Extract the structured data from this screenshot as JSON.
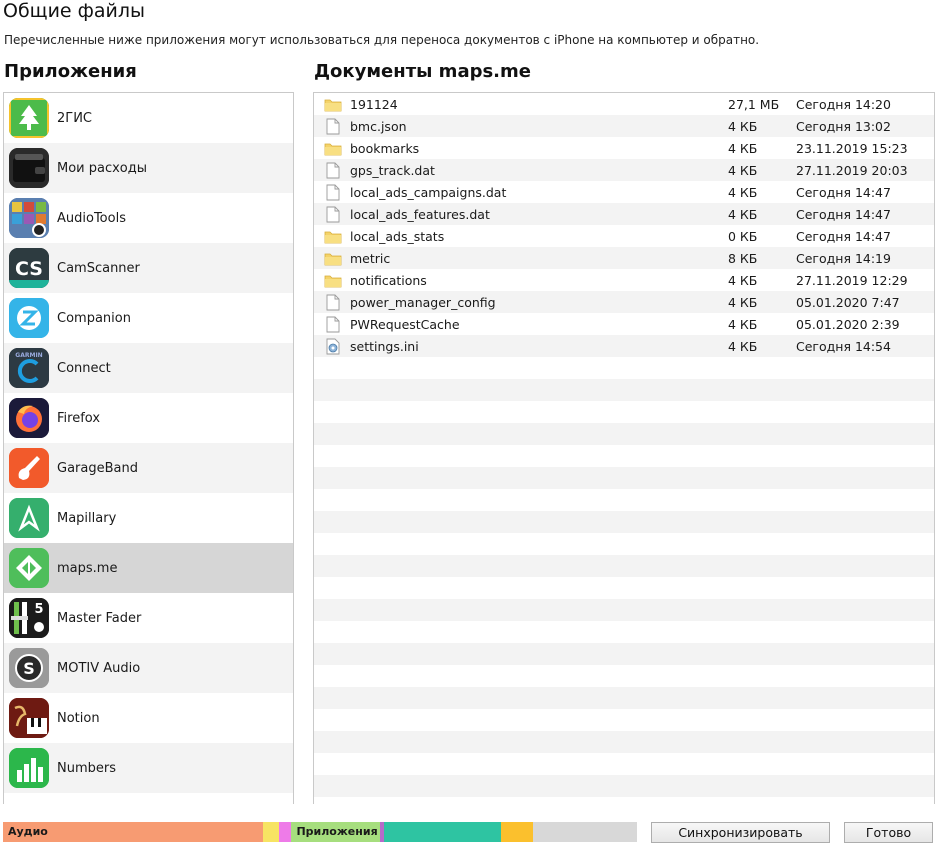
{
  "header": {
    "title": "Общие файлы",
    "subtitle": "Перечисленные ниже приложения могут использоваться для переноса документов с iPhone на компьютер и обратно."
  },
  "apps_section": {
    "title": "Приложения"
  },
  "docs_section": {
    "title": "Документы maps.me"
  },
  "apps": [
    {
      "label": "2ГИС",
      "icon": "2gis-icon",
      "color": "#4cbb4a"
    },
    {
      "label": "Мои расходы",
      "icon": "wallet-icon",
      "color": "#2b2b2b"
    },
    {
      "label": "AudioTools",
      "icon": "audiotools-icon",
      "color": "#3a5c8c"
    },
    {
      "label": "CamScanner",
      "icon": "camscanner-icon",
      "color": "#2a3a3f"
    },
    {
      "label": "Companion",
      "icon": "companion-icon",
      "color": "#3ab5e6"
    },
    {
      "label": "Connect",
      "icon": "garmin-connect-icon",
      "color": "#2e3b44"
    },
    {
      "label": "Firefox",
      "icon": "firefox-icon",
      "color": "#1c1b3a"
    },
    {
      "label": "GarageBand",
      "icon": "garageband-icon",
      "color": "#f05a2a"
    },
    {
      "label": "Mapillary",
      "icon": "mapillary-icon",
      "color": "#35af6d"
    },
    {
      "label": "maps.me",
      "icon": "mapsme-icon",
      "color": "#4fbe5b"
    },
    {
      "label": "Master Fader",
      "icon": "master-fader-icon",
      "color": "#1d1d1d"
    },
    {
      "label": "MOTIV Audio",
      "icon": "motiv-audio-icon",
      "color": "#8a8a8a"
    },
    {
      "label": "Notion",
      "icon": "notion-icon",
      "color": "#7a1b10"
    },
    {
      "label": "Numbers",
      "icon": "numbers-icon",
      "color": "#2bb64a"
    }
  ],
  "selected_app": "maps.me",
  "documents": [
    {
      "name": "191124",
      "size": "27,1 МБ",
      "date": "Сегодня 14:20",
      "type": "folder"
    },
    {
      "name": "bmc.json",
      "size": "4 КБ",
      "date": "Сегодня 13:02",
      "type": "file"
    },
    {
      "name": "bookmarks",
      "size": "4 КБ",
      "date": "23.11.2019 15:23",
      "type": "folder"
    },
    {
      "name": "gps_track.dat",
      "size": "4 КБ",
      "date": "27.11.2019 20:03",
      "type": "file"
    },
    {
      "name": "local_ads_campaigns.dat",
      "size": "4 КБ",
      "date": "Сегодня 14:47",
      "type": "file"
    },
    {
      "name": "local_ads_features.dat",
      "size": "4 КБ",
      "date": "Сегодня 14:47",
      "type": "file"
    },
    {
      "name": "local_ads_stats",
      "size": "0 КБ",
      "date": "Сегодня 14:47",
      "type": "folder"
    },
    {
      "name": "metric",
      "size": "8 КБ",
      "date": "Сегодня 14:19",
      "type": "folder"
    },
    {
      "name": "notifications",
      "size": "4 КБ",
      "date": "27.11.2019 12:29",
      "type": "folder"
    },
    {
      "name": "power_manager_config",
      "size": "4 КБ",
      "date": "05.01.2020 7:47",
      "type": "file"
    },
    {
      "name": "PWRequestCache",
      "size": "4 КБ",
      "date": "05.01.2020 2:39",
      "type": "file"
    },
    {
      "name": "settings.ini",
      "size": "4 КБ",
      "date": "Сегодня 14:54",
      "type": "settings"
    }
  ],
  "storage": {
    "segments": [
      {
        "label": "Аудио",
        "color": "#f79b72",
        "fraction": 0.41
      },
      {
        "label": "",
        "color": "#f7e463",
        "fraction": 0.025
      },
      {
        "label": "",
        "color": "#ee7be8",
        "fraction": 0.02
      },
      {
        "label": "Приложения",
        "color": "#a6de7e",
        "fraction": 0.14
      },
      {
        "label": "",
        "color": "#b76bc9",
        "fraction": 0.006
      },
      {
        "label": "",
        "color": "#2ec4a2",
        "fraction": 0.185
      },
      {
        "label": "",
        "color": "#fbc02d",
        "fraction": 0.05
      },
      {
        "label": "",
        "color": "#d8d8d8",
        "fraction": 0.164
      }
    ]
  },
  "buttons": {
    "sync_label": "Синхронизировать",
    "done_label": "Готово"
  }
}
